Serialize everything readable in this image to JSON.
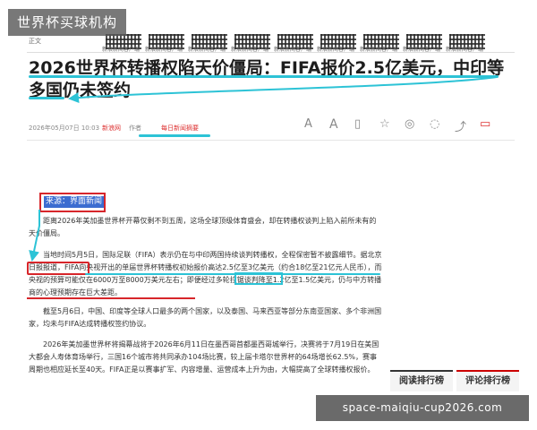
{
  "watermark": {
    "text": "世界杯买球机构"
  },
  "header": {
    "channel": "正文",
    "qr_labels": [
      "新浪新闻客户端",
      "新浪新闻客户端",
      "新浪新闻客户端",
      "新浪新闻客户端",
      "新浪新闻客户端",
      "新浪新闻客户端",
      "新浪新闻客户端",
      "新浪新闻客户端",
      "新浪新闻客户端"
    ]
  },
  "article": {
    "title": "2026世界杯转播权陷天价僵局：FIFA报价2.5亿美元，中印等多国仍未签约",
    "meta": {
      "date": "2026年05月07日 10:03",
      "site": "新浪网",
      "author_label": "作者",
      "source_link": "每日新闻摘要"
    },
    "meta_icons": [
      "font-small-icon",
      "font-large-icon",
      "bookmark-icon",
      "star-icon",
      "weibo-icon",
      "wechat-icon",
      "share-icon",
      "comment-icon"
    ],
    "source_tag": "来源：界面新闻",
    "paragraphs": {
      "p1": "距离2026年美加墨世界杯开幕仅剩不到五周，这场全球顶级体育盛会，却在转播权谈判上陷入前所未有的天价僵局。",
      "p2_line1": "当地时间5月5日，国际足联（FIFA）表示仍在与中印两国持续谈判转播权，全程保密暂不披露细节。",
      "p2_line2a": "据北京日报报道",
      "p2_rest": "，FIFA向央视开出的单届世界杯转播权初始报价高达2.5亿至3亿美元（约合18亿至21亿元人民币），而央视的预算可能仅在6000万至8000万美元左右；即便经过多轮拉锯谈判降至1.2亿至1.5亿美元，仍与中方转播商的心理预期存在巨大差距。",
      "p3": "截至5月6日，中国、印度等全球人口最多的两个国家，以及泰国、马来西亚等部分东南亚国家、多个非洲国家，均未与FIFA达成转播权签约协议。",
      "p4": "2026年美加墨世界杯将揭幕战将于2026年6月11日在墨西哥首都墨西哥城举行，决赛将于7月19日在美国大都会人寿体育场举行，三国16个城市将共同承办104场比赛，较上届卡塔尔世界杯的64场增长62.5%，赛事周期也相应延长至40天。FIFA正是以赛事扩军、内容增量、运营成本上升为由，大幅提高了全球转播权报价。"
    }
  },
  "sidebar": {
    "tab1": "阅读排行榜",
    "tab2": "评论排行榜"
  },
  "url_banner": {
    "text": "space-maiqiu-cup2026.com"
  },
  "colors": {
    "annotation_red": "#d7262b",
    "annotation_cyan": "#2dc3d6",
    "source_tag_blue": "#3b6cd0"
  }
}
